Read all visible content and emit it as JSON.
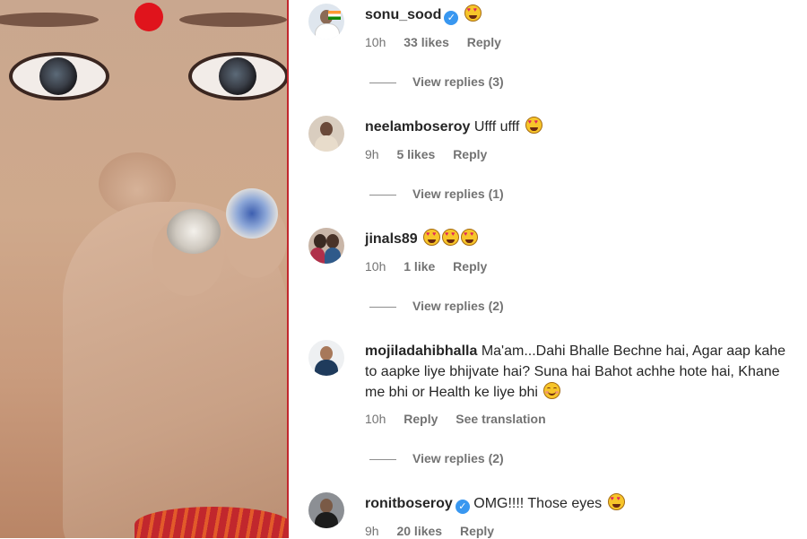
{
  "photo": {
    "alt_subject": "woman-face-photo"
  },
  "comments": [
    {
      "username": "sonu_sood",
      "verified": true,
      "text": "",
      "emojis": [
        "heart-eyes"
      ],
      "time": "10h",
      "likes": "33 likes",
      "reply": "Reply",
      "translate": "",
      "view_replies": "View replies (3)"
    },
    {
      "username": "neelamboseroy",
      "verified": false,
      "text": "Ufff ufff",
      "emojis": [
        "heart-eyes"
      ],
      "time": "9h",
      "likes": "5 likes",
      "reply": "Reply",
      "translate": "",
      "view_replies": "View replies (1)"
    },
    {
      "username": "jinals89",
      "verified": false,
      "text": "",
      "emojis": [
        "heart-eyes",
        "heart-eyes",
        "heart-eyes"
      ],
      "time": "10h",
      "likes": "1 like",
      "reply": "Reply",
      "translate": "",
      "view_replies": "View replies (2)"
    },
    {
      "username": "mojiladahibhalla",
      "verified": false,
      "text": "Ma'am...Dahi Bhalle Bechne hai, Agar aap kahe to aapke liye bhijvate hai? Suna hai Bahot achhe hote hai, Khane me bhi or Health ke liye bhi",
      "emojis": [
        "smiling-face"
      ],
      "time": "10h",
      "likes": "",
      "reply": "Reply",
      "translate": "See translation",
      "view_replies": "View replies (2)"
    },
    {
      "username": "ronitboseroy",
      "verified": true,
      "text": "OMG!!!! Those eyes",
      "emojis": [
        "heart-eyes"
      ],
      "time": "9h",
      "likes": "20 likes",
      "reply": "Reply",
      "translate": "",
      "view_replies": ""
    }
  ],
  "colors": {
    "accent_red": "#c1272d",
    "verified_blue": "#3897f0",
    "muted_text": "#737373"
  }
}
